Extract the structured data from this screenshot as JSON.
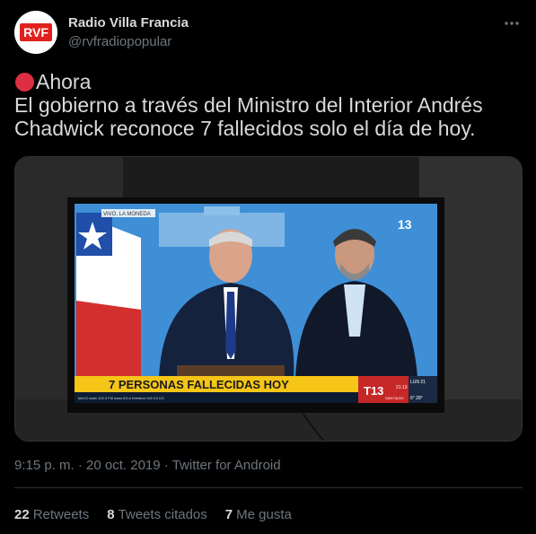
{
  "author": {
    "display_name": "Radio Villa Francia",
    "handle": "@rvfradiopopular",
    "avatar_text": "RVF"
  },
  "tweet": {
    "line1": "Ahora",
    "line2": "El gobierno a través del  Ministro del Interior Andrés",
    "line3": "Chadwick reconoce 7 fallecidos solo el día de hoy."
  },
  "media": {
    "live_label": "VIVO, LA MONEDA",
    "channel_logo": "13",
    "banner_text": "7 PERSONAS FALLECIDAS HOY",
    "network_logo": "T13",
    "clock": "21:13",
    "date_badge": "LUN 21",
    "temperature": "6° 28°",
    "city": "SANTIAGO",
    "ticker": "tele13 radio 103.3 FM    www.t13.cl    teletrece    t13    t13    t13"
  },
  "meta": {
    "time": "9:15 p. m.",
    "separator": "·",
    "date": "20 oct. 2019",
    "source": "Twitter for Android"
  },
  "stats": {
    "retweets_count": "22",
    "retweets_label": "Retweets",
    "quotes_count": "8",
    "quotes_label": "Tweets citados",
    "likes_count": "7",
    "likes_label": "Me gusta"
  },
  "colors": {
    "background": "#000000",
    "text": "#d9d9d9",
    "muted": "#6e767d",
    "divider": "#2f3336",
    "avatar_red": "#e0211d",
    "banner_yellow": "#f5c518"
  }
}
